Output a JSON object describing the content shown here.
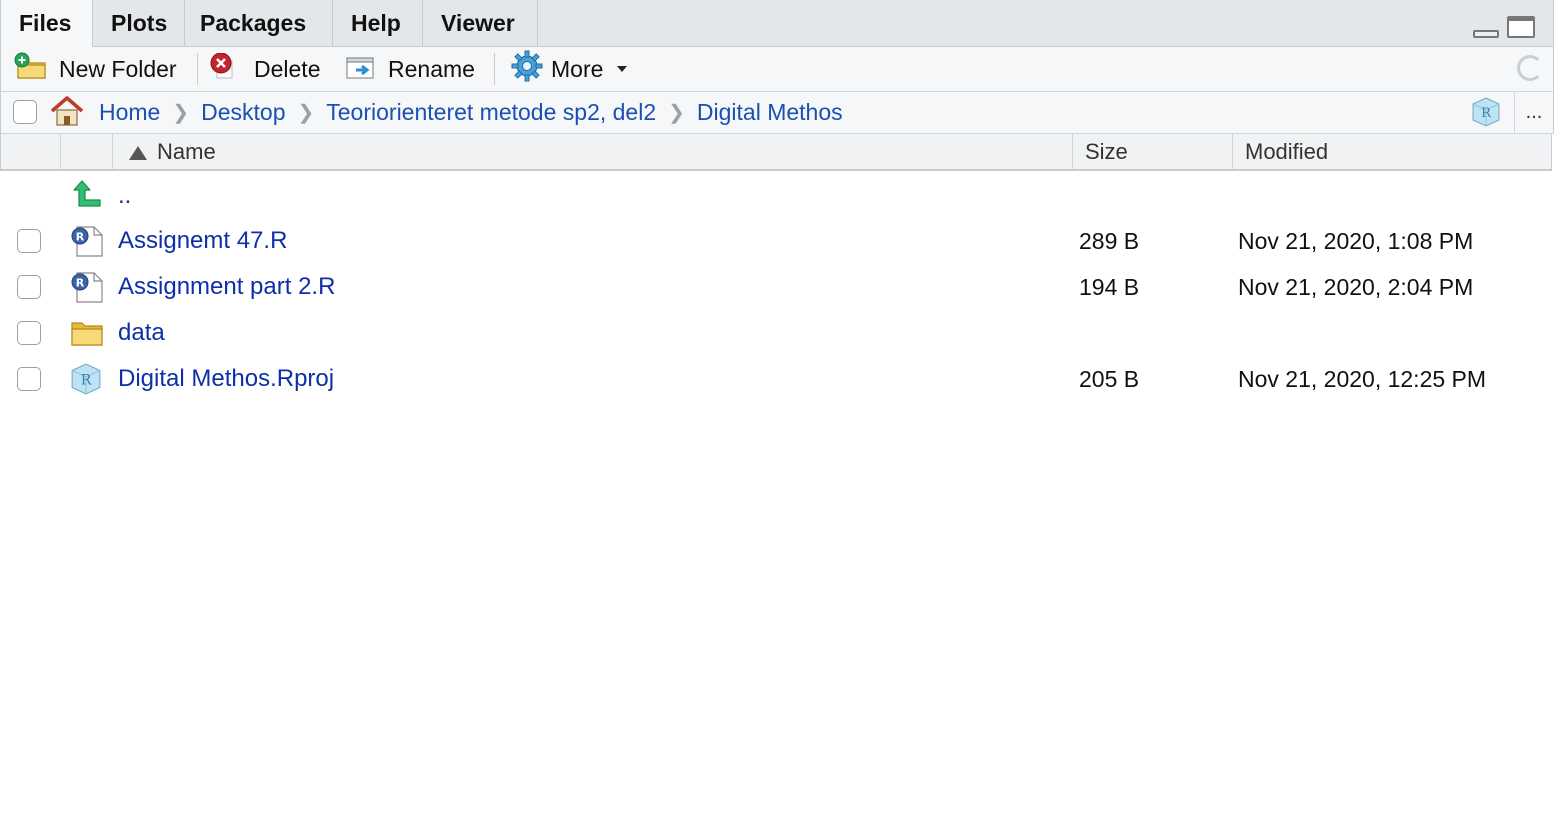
{
  "tabs": [
    {
      "label": "Files",
      "active": true
    },
    {
      "label": "Plots"
    },
    {
      "label": "Packages"
    },
    {
      "label": "Help"
    },
    {
      "label": "Viewer"
    }
  ],
  "toolbar": {
    "new_folder": "New Folder",
    "delete": "Delete",
    "rename": "Rename",
    "more": "More"
  },
  "breadcrumb": [
    "Home",
    "Desktop",
    "Teoriorienteret metode sp2, del2",
    "Digital Methos"
  ],
  "breadcrumb_more": "...",
  "columns": {
    "name": "Name",
    "size": "Size",
    "modified": "Modified"
  },
  "parent_link": "..",
  "files": [
    {
      "name": "Assignemt 47.R",
      "size": "289 B",
      "modified": "Nov 21, 2020, 1:08 PM",
      "icon": "r-file-icon"
    },
    {
      "name": "Assignment part 2.R",
      "size": "194 B",
      "modified": "Nov 21, 2020, 2:04 PM",
      "icon": "r-file-icon"
    },
    {
      "name": "data",
      "size": "",
      "modified": "",
      "icon": "folder-icon"
    },
    {
      "name": "Digital Methos.Rproj",
      "size": "205 B",
      "modified": "Nov 21, 2020, 12:25 PM",
      "icon": "rproj-icon"
    }
  ],
  "colors": {
    "link": "#0f2fa8",
    "crumb": "#1a4fb3",
    "tabbar": "#e4e7ea",
    "toolbar": "#f5f7f8"
  }
}
